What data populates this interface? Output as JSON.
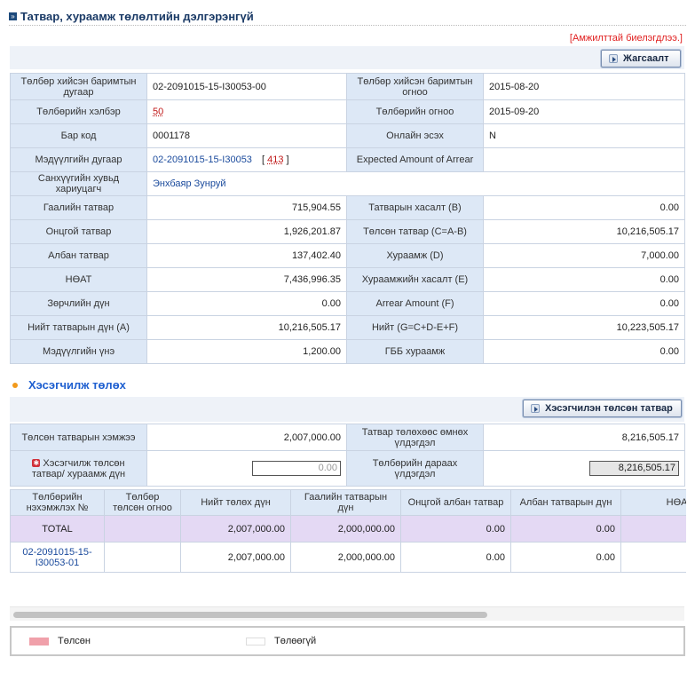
{
  "header": {
    "title": "Татвар, хураамж төлөлтийн дэлгэрэнгүй",
    "success_message": "[Амжилттай биелэгдлээ.]",
    "back_button": "Жагсаалт"
  },
  "details": {
    "doc_no_label": "Төлбөр хийсэн баримтын дугаар",
    "doc_no": "02-2091015-15-I30053-00",
    "doc_date_label": "Төлбөр хийсэн баримтын огноо",
    "doc_date": "2015-08-20",
    "pay_type_label": "Төлбөрийн хэлбэр",
    "pay_type": "50",
    "pay_date_label": "Төлбөрийн огноо",
    "pay_date": "2015-09-20",
    "barcode_label": "Бар код",
    "barcode": "0001178",
    "online_label": "Онлайн эсэх",
    "online": "N",
    "decl_no_label": "Мэдүүлгийн дугаар",
    "decl_no": "02-2091015-15-I30053",
    "decl_code_prefix": "[",
    "decl_code": "413",
    "decl_code_suffix": "]",
    "expected_label": "Expected Amount of Arrear",
    "expected": "",
    "officer_label": "Санхүүгийн хувьд хариуцагч",
    "officer": "Энхбаяр Зунруй",
    "customs_label": "Гаалийн татвар",
    "customs": "715,904.55",
    "deduct_label": "Татварын хасалт (B)",
    "deduct": "0.00",
    "excise_label": "Онцгой татвар",
    "excise": "1,926,201.87",
    "paid_tax_label": "Төлсөн татвар (C=A-B)",
    "paid_tax": "10,216,505.17",
    "official_label": "Албан татвар",
    "official": "137,402.40",
    "fee_label": "Хураамж (D)",
    "fee": "7,000.00",
    "vat_label": "НӨАТ",
    "vat": "7,436,996.35",
    "fee_deduct_label": "Хураамжийн хасалт (E)",
    "fee_deduct": "0.00",
    "violation_label": "Зөрчлийн дүн",
    "violation": "0.00",
    "arrear_label": "Arrear Amount (F)",
    "arrear": "0.00",
    "total_tax_label": "Нийт татварын дүн (A)",
    "total_tax": "10,216,505.17",
    "grand_total_label": "Нийт (G=C+D-E+F)",
    "grand_total": "10,223,505.17",
    "decl_price_label": "Мэдүүлгийн үнэ",
    "decl_price": "1,200.00",
    "gbb_label": "ГББ хураамж",
    "gbb": "0.00"
  },
  "installment": {
    "section_title": "Хэсэгчилж төлөх",
    "button": "Хэсэгчилэн төлсөн татвар",
    "paid_amount_label": "Төлсөн татварын хэмжээ",
    "paid_amount": "2,007,000.00",
    "balance_before_label": "Татвар төлөхөөс өмнөх үлдэгдэл",
    "balance_before": "8,216,505.17",
    "partial_label": "Хэсэгчилж төлсөн татвар/ хураамж дүн",
    "partial_value": "0.00",
    "balance_after_label": "Төлбөрийн дараах үлдэгдэл",
    "balance_after": "8,216,505.17"
  },
  "table": {
    "columns": [
      "Төлбөрийн нэхэмжлэх №",
      "Төлбөр төлсөн огноо",
      "Нийт төлөх дүн",
      "Гаалийн татварын дүн",
      "Онцгой албан татвар",
      "Албан татварын дүн",
      "НӨАТ"
    ],
    "total_row": [
      "TOTAL",
      "",
      "2,007,000.00",
      "2,000,000.00",
      "0.00",
      "0.00",
      ""
    ],
    "rows": [
      [
        "02-2091015-15-I30053-01",
        "",
        "2,007,000.00",
        "2,000,000.00",
        "0.00",
        "0.00",
        ""
      ]
    ]
  },
  "scroll": {
    "visible_fraction": 0.71
  },
  "legend": {
    "paid": "Төлсөн",
    "unpaid": "Төлөөгүй",
    "paid_color": "#f0a0aa",
    "unpaid_color": "#ffffff"
  }
}
